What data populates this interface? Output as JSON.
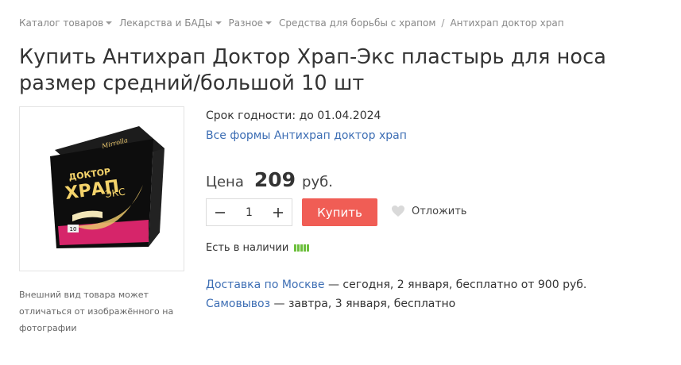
{
  "breadcrumb": {
    "items": [
      {
        "label": "Каталог товаров",
        "dropdown": true
      },
      {
        "label": "Лекарства и БАДы",
        "dropdown": true
      },
      {
        "label": "Разное",
        "dropdown": true
      },
      {
        "label": "Средства для борьбы с храпом",
        "dropdown": false
      },
      {
        "label": "Антихрап доктор храп",
        "dropdown": false
      }
    ],
    "separator": "/"
  },
  "product": {
    "title": "Купить Антихрап Доктор Храп-Экс пластырь для носа размер средний/большой 10 шт",
    "image_note": "Внешний вид товара может отличаться от изображённого на фотографии",
    "package_text": {
      "brand": "Mirrolla",
      "line1": "ДОКТОР",
      "line2": "ХРАП",
      "line3": "ЭКС",
      "count": "10"
    },
    "expiry_label": "Срок годности: до 01.04.2024",
    "forms_link": "Все формы Антихрап доктор храп",
    "price_label": "Цена",
    "price_value": "209",
    "price_currency": "руб.",
    "quantity": "1",
    "buy_label": "Купить",
    "postpone_label": "Отложить",
    "stock_label": "Есть в наличии",
    "stock_level_bars": 5
  },
  "delivery": {
    "courier_link": "Доставка по Москве",
    "courier_text": " — сегодня, 2 января, бесплатно от 900 руб.",
    "pickup_link": "Самовывоз",
    "pickup_text": " — завтра, 3 января, бесплатно"
  },
  "colors": {
    "link": "#3d6eb4",
    "buy_button": "#f05d55",
    "stock_bar": "#6cbf3c"
  },
  "icons": {
    "minus": "minus-icon",
    "plus": "plus-icon",
    "heart": "heart-icon",
    "caret": "chevron-down-icon"
  }
}
